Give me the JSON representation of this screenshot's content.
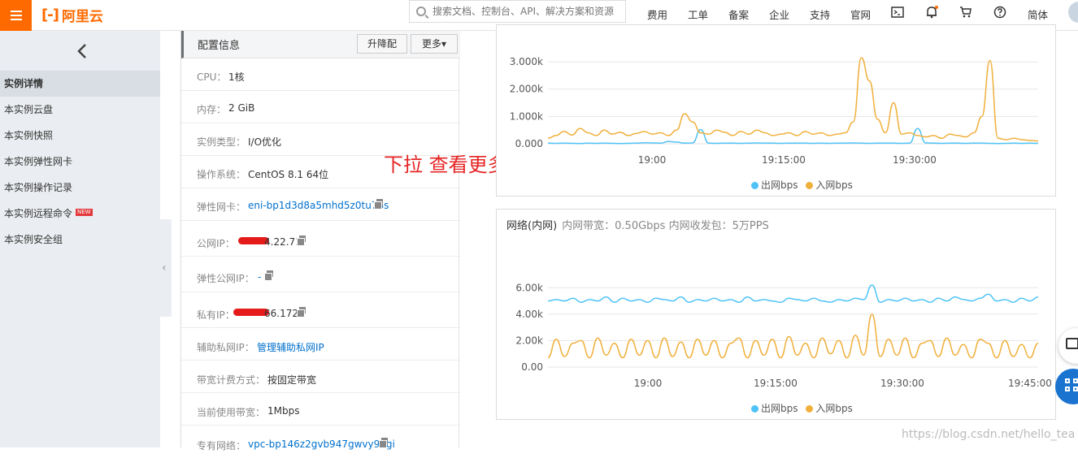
{
  "header": {
    "logo_mark": "[-]",
    "logo_name": "阿里云",
    "search_placeholder": "搜索文档、控制台、API、解决方案和资源",
    "nav": [
      "费用",
      "工单",
      "备案",
      "企业",
      "支持",
      "官网"
    ],
    "lang": "简体",
    "icons": [
      "terminal-icon",
      "bell-icon",
      "cart-icon",
      "help-icon"
    ]
  },
  "sidebar": {
    "items": [
      {
        "label": "实例详情",
        "active": true
      },
      {
        "label": "本实例云盘"
      },
      {
        "label": "本实例快照"
      },
      {
        "label": "本实例弹性网卡"
      },
      {
        "label": "本实例操作记录"
      },
      {
        "label": "本实例远程命令",
        "badge": "NEW"
      },
      {
        "label": "本实例安全组"
      }
    ]
  },
  "config": {
    "title": "配置信息",
    "upgrade_label": "升降配",
    "more_label": "更多▾",
    "rows": [
      {
        "key": "CPU：",
        "value": "1核"
      },
      {
        "key": "内存：",
        "value": "2 GiB"
      },
      {
        "key": "实例类型：",
        "value": "I/O优化"
      },
      {
        "key": "操作系统：",
        "value": "CentOS 8.1 64位"
      },
      {
        "key": "弹性网卡：",
        "value": "eni-bp1d3d8a5mhd5z0tu78s"
      },
      {
        "key": "公网IP：",
        "value": "4.22.71"
      },
      {
        "key": "弹性公网IP：",
        "value": "-"
      },
      {
        "key": "私有IP：",
        "value": "66.172"
      },
      {
        "key": "辅助私网IP：",
        "value": "管理辅助私网IP"
      },
      {
        "key": "带宽计费方式：",
        "value": "按固定带宽"
      },
      {
        "key": "当前使用带宽：",
        "value": "1Mbps"
      },
      {
        "key": "专有网络：",
        "value": "vpc-bp146z2gvb947gwvy9dgi"
      }
    ]
  },
  "annotation": "下拉 查看更多配置",
  "watermark": "https://blog.csdn.net/hello_tea",
  "colors": {
    "out": "#4fc3f7",
    "in": "#f0b03c",
    "accent": "#ff6a00"
  },
  "chart_data": [
    {
      "type": "line",
      "title": "",
      "y_ticks": [
        "3.000k",
        "2.000k",
        "1.000k",
        "0.000"
      ],
      "x_ticks": [
        "19:00",
        "19:15:00",
        "19:30:00"
      ],
      "ylim": [
        0,
        3300
      ],
      "series": [
        {
          "name": "出网bps",
          "values": [
            20,
            15,
            20,
            15,
            10,
            20,
            15,
            20,
            15,
            10,
            15,
            20,
            40,
            30,
            20,
            80,
            60,
            20,
            30,
            520,
            20,
            15,
            20,
            25,
            15,
            20,
            30,
            25,
            20,
            15,
            20,
            25,
            20,
            15,
            20,
            15,
            20,
            25,
            30,
            20,
            15,
            20,
            25,
            20,
            15,
            20,
            560,
            30,
            20,
            15,
            20,
            25,
            15,
            20,
            20,
            15,
            10,
            15,
            20,
            15,
            20,
            15
          ]
        },
        {
          "name": "入网bps",
          "values": [
            200,
            300,
            450,
            320,
            560,
            400,
            300,
            500,
            350,
            420,
            300,
            380,
            450,
            350,
            400,
            300,
            500,
            1100,
            800,
            400,
            350,
            500,
            420,
            300,
            450,
            350,
            500,
            400,
            300,
            350,
            400,
            300,
            450,
            350,
            400,
            300,
            350,
            400,
            800,
            3150,
            2300,
            900,
            400,
            1500,
            350,
            400,
            300,
            250,
            300,
            200,
            350,
            300,
            250,
            400,
            1000,
            3050,
            200,
            150,
            200,
            150,
            120,
            100
          ]
        }
      ]
    },
    {
      "type": "line",
      "title": "网络(内网)",
      "subtitle": "内网带宽：0.50Gbps 内网收发包：5万PPS",
      "y_ticks": [
        "6.00k",
        "4.00k",
        "2.00k",
        "0.00"
      ],
      "x_ticks": [
        "19:00",
        "19:15:00",
        "19:30:00",
        "19:45:00"
      ],
      "ylim": [
        0,
        7000
      ],
      "series": [
        {
          "name": "出网bps",
          "values": [
            5000,
            5100,
            5000,
            5200,
            4900,
            5100,
            5000,
            5300,
            4900,
            5200,
            5000,
            5100,
            4900,
            5200,
            5100,
            5000,
            5300,
            4900,
            5100,
            5000,
            5200,
            5000,
            5100,
            4900,
            5300,
            5000,
            5100,
            5000,
            4900,
            5200,
            5100,
            5000,
            5200,
            5000,
            4900,
            5100,
            5000,
            5200,
            5100,
            6200,
            4900,
            5100,
            5000,
            5200,
            5000,
            5100,
            4900,
            5200,
            5000,
            5300,
            5100,
            5000,
            5200,
            5500,
            5000,
            5100,
            4900,
            5200,
            5000,
            5300
          ]
        },
        {
          "name": "入网bps",
          "values": [
            700,
            2100,
            800,
            1800,
            2000,
            700,
            2200,
            900,
            1800,
            700,
            2100,
            900,
            2000,
            700,
            2200,
            800,
            1900,
            700,
            2100,
            900,
            2000,
            700,
            1800,
            2200,
            700,
            2000,
            900,
            2100,
            700,
            2300,
            900,
            1800,
            700,
            2200,
            1000,
            2000,
            700,
            2400,
            900,
            4000,
            800,
            2100,
            900,
            2200,
            700,
            1800,
            2000,
            800,
            2200,
            900,
            1700,
            700,
            2100,
            1800,
            700,
            2000,
            800,
            1700,
            700,
            1800
          ]
        }
      ]
    }
  ],
  "legend": {
    "out": "出网bps",
    "in": "入网bps"
  }
}
